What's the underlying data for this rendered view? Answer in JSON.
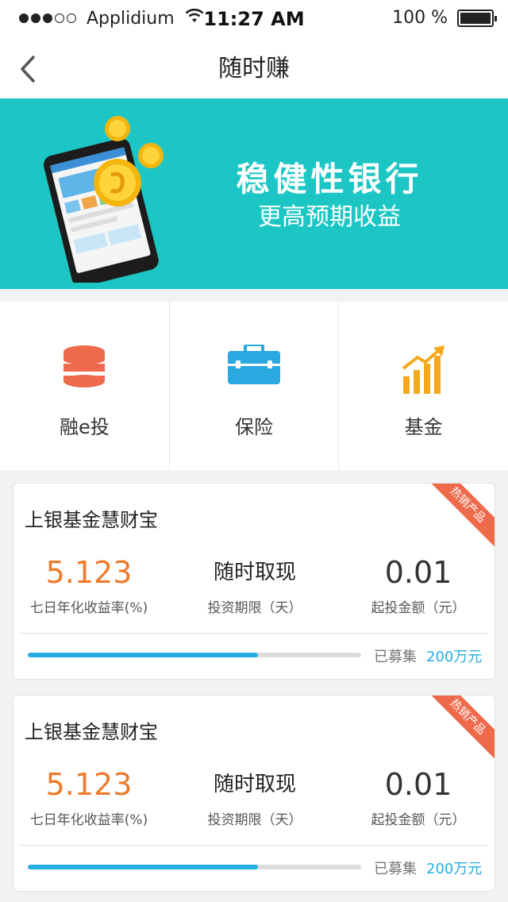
{
  "status_bar": {
    "carrier": "Applidium",
    "time": "11:27 AM",
    "battery": "100 %",
    "signal_bars": 3,
    "signal_total": 5
  },
  "nav": {
    "title": "随时赚",
    "back_icon": "chevron-left-icon"
  },
  "banner": {
    "title": "稳健性银行",
    "subtitle": "更高预期收益",
    "background": "#1cc6c4"
  },
  "categories": [
    {
      "label": "融e投",
      "icon": "database-icon",
      "color": "#ee6a4d"
    },
    {
      "label": "保险",
      "icon": "briefcase-icon",
      "color": "#2aa8e0"
    },
    {
      "label": "基金",
      "icon": "growth-chart-icon",
      "color": "#f4a81c"
    }
  ],
  "products": [
    {
      "title": "上银基金慧财宝",
      "badge": "热销产品",
      "rate": "5.123",
      "rate_label": "七日年化收益率(%)",
      "term": "随时取现",
      "term_label": "投资期限（天）",
      "min": "0.01",
      "min_label": "起投金额（元）",
      "raised_label": "已募集",
      "raised_amount": "200万元",
      "progress": 0.69
    },
    {
      "title": "上银基金慧财宝",
      "badge": "热销产品",
      "rate": "5.123",
      "rate_label": "七日年化收益率(%)",
      "term": "随时取现",
      "term_label": "投资期限（天）",
      "min": "0.01",
      "min_label": "起投金额（元）",
      "raised_label": "已募集",
      "raised_amount": "200万元",
      "progress": 0.69
    }
  ],
  "colors": {
    "accent_blue": "#25aee0",
    "rate_orange": "#ee7b2b",
    "badge_red": "#ef6a4b"
  }
}
